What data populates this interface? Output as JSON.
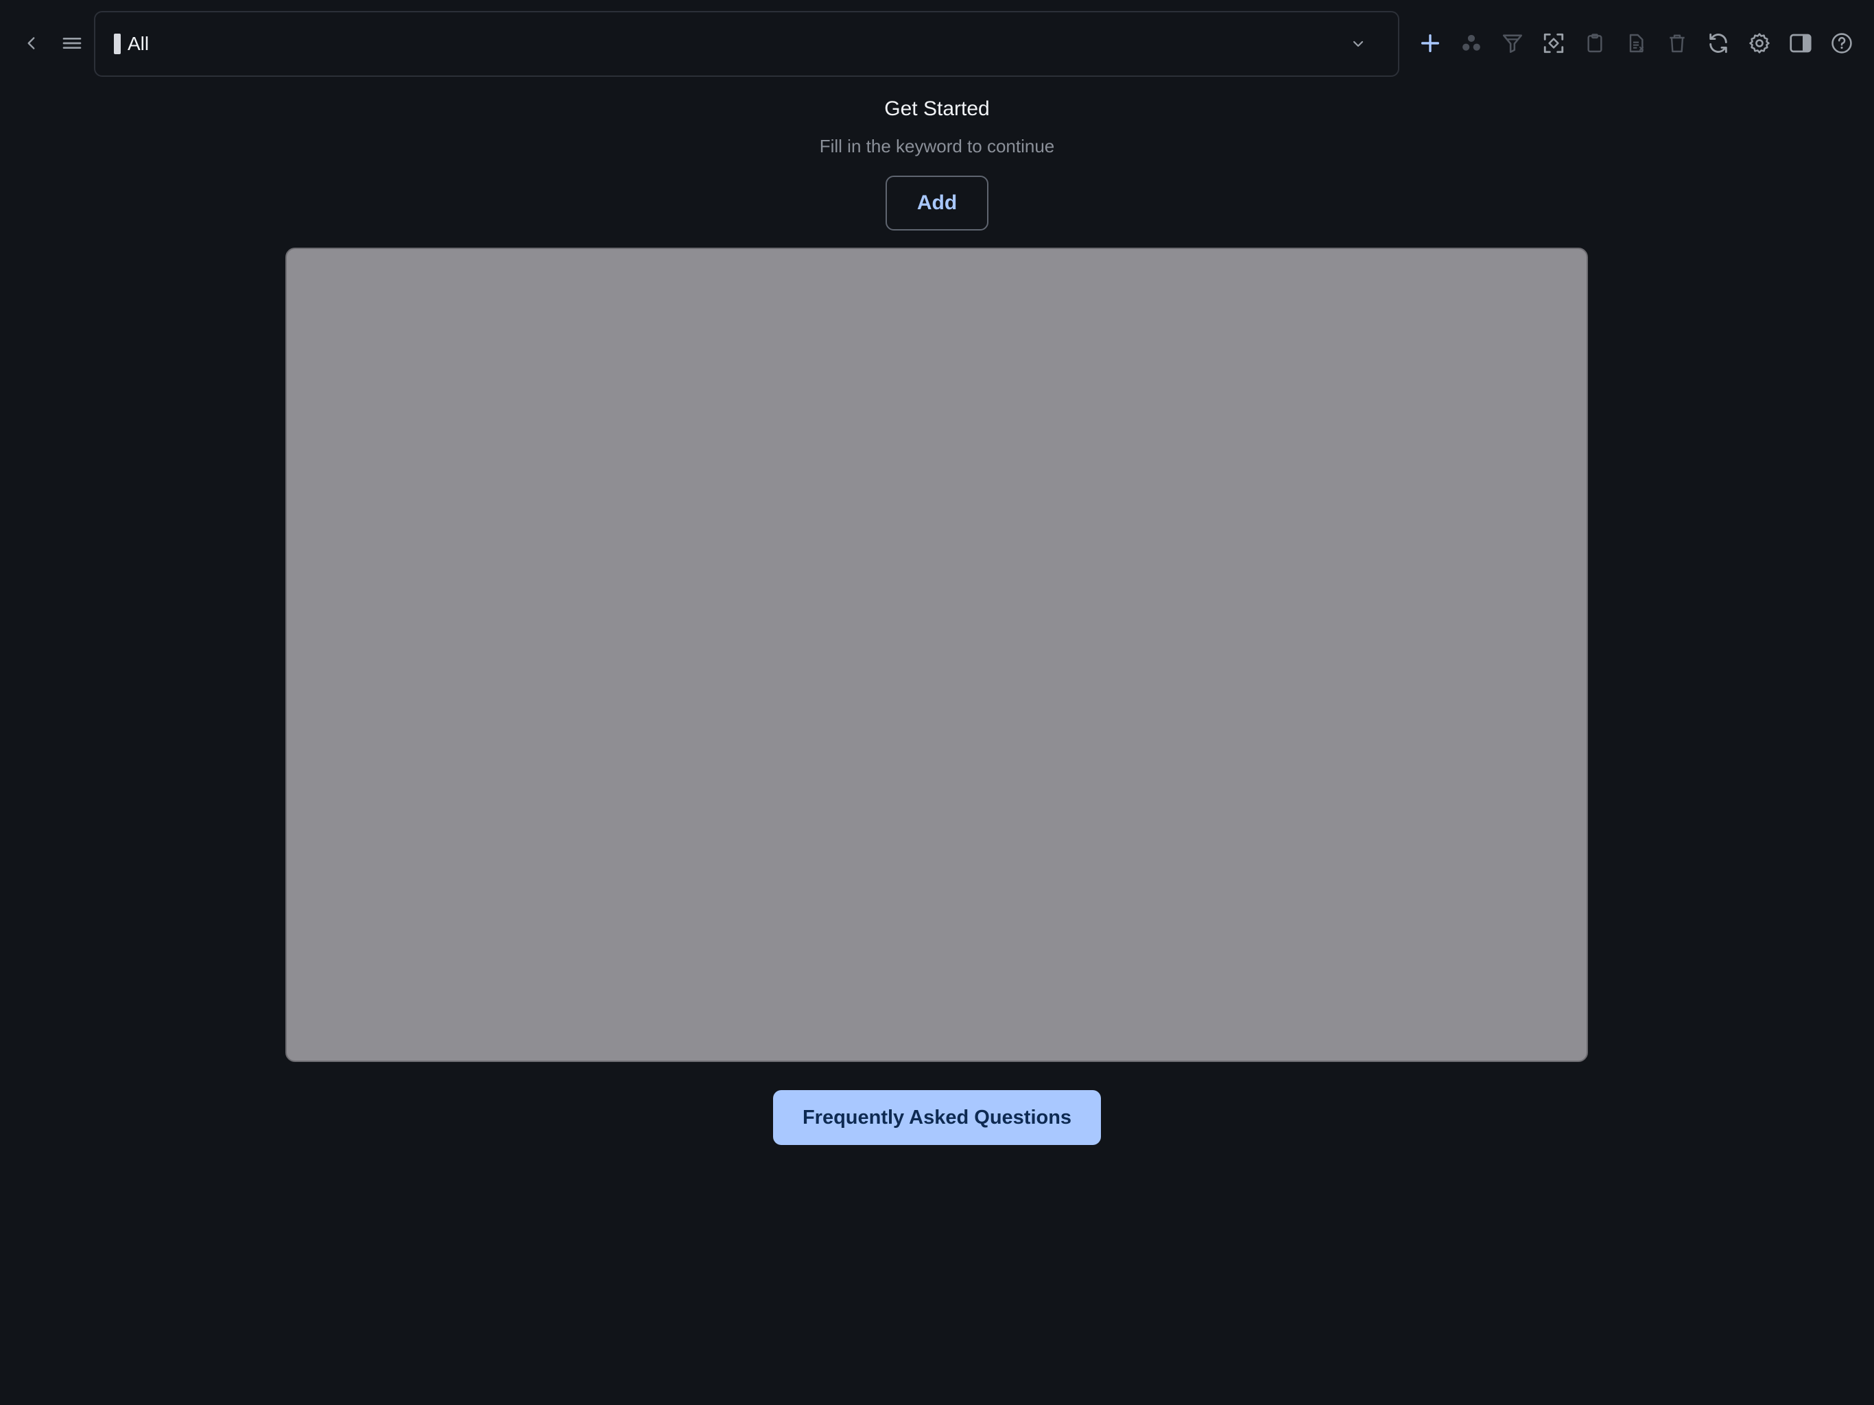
{
  "selector": {
    "value": "All"
  },
  "toolbar": {
    "icons": [
      "plus-icon",
      "group-icon",
      "filter-icon",
      "scan-icon",
      "clipboard-icon",
      "document-icon",
      "trash-icon",
      "refresh-icon",
      "gear-icon",
      "sidebar-icon",
      "help-icon"
    ]
  },
  "main": {
    "title": "Get Started",
    "subtitle": "Fill in the keyword to continue",
    "add_label": "Add",
    "faq_label": "Frequently Asked Questions"
  },
  "colors": {
    "background": "#111419",
    "accent": "#a9c8ff",
    "panel": "#8f8e93"
  }
}
